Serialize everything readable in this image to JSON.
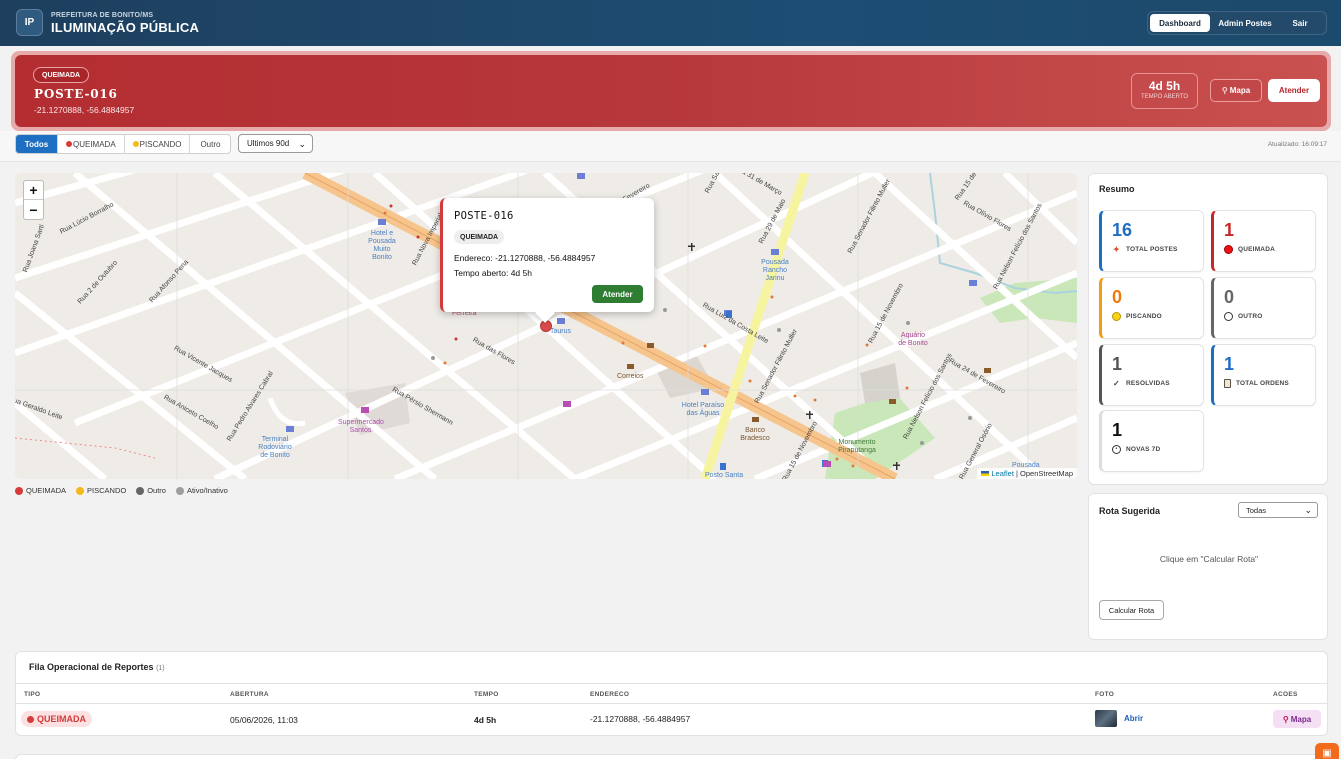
{
  "header": {
    "logo": "IP",
    "subtitle": "PREFEITURA DE BONITO/MS",
    "title": "ILUMINAÇÃO PÚBLICA",
    "nav": [
      {
        "label": "Dashboard",
        "active": true
      },
      {
        "label": "Admin Postes",
        "active": false
      },
      {
        "label": "Sair",
        "active": false
      }
    ]
  },
  "alert": {
    "badge": "QUEIMADA",
    "title": "POSTE-016",
    "coords": "-21.1270888, -56.4884957",
    "time_value": "4d 5h",
    "time_label": "TEMPO ABERTO",
    "map_button": "Mapa",
    "attend_button": "Atender"
  },
  "filters": {
    "segments": [
      "Todos",
      "QUEIMADA",
      "PISCANDO",
      "Outro"
    ],
    "period": "Ultimos 90d",
    "updated": "Atualizado: 16:09:17"
  },
  "map": {
    "zoom_in": "+",
    "zoom_out": "−",
    "attribution_leaflet": "Leaflet",
    "attribution_osm": "| OpenStreetMap",
    "popup": {
      "title": "POSTE-016",
      "badge": "QUEIMADA",
      "endereco": "Endereco: -21.1270888, -56.4884957",
      "tempo": "Tempo aberto: 4d 5h",
      "button": "Atender"
    },
    "labels": {
      "hotel_bonito": "Hotel e Pousada Muito Bonito",
      "pousada_rancho": "Pousada Rancho Jarinu",
      "terminal": "Terminal Rodoviário de Bonito",
      "supermercado": "Supermercado Santos",
      "correios": "Correios",
      "banco": "Banco Bradesco",
      "hotel_paraiso": "Hotel Paraíso das Águas",
      "monumento": "Monumento Piraputanga",
      "aquario": "Aquário de Bonito",
      "pousada": "Pousada",
      "taurus": "Taurus",
      "ferreira": "Ferreira",
      "posto": "Posto Santa",
      "rua_lucio": "Rua Lúcio Borralho",
      "rua_joana": "Rua Joana Sarti",
      "rua_2out": "Rua 2 de Outubro",
      "rua_afonso": "Rua Afonso Pena",
      "rua_vicente": "Rua Vicente Jacques",
      "rua_aniceto": "Rua Aniceto Coelho",
      "rua_pedro": "Rua Pedro Alvares Cabral",
      "rua_geraldo": "Rua Geraldo Leite",
      "rua_persio": "Rua Pérsio Shermann",
      "rua_flores": "Rua das Flores",
      "rua_luiz": "Rua Luiz da Costa Leite",
      "rua_29": "Rua 29 de Maio",
      "rua_senador": "Rua Senador Filinto Muller",
      "rua_15nov": "Rua 15 de Novembro",
      "rua_nelson": "Rua Nelson Felício dos Santos",
      "rua_24fev": "Rua 24 de Fevereiro",
      "rua_olivio": "Rua Olívio Flores",
      "rua_marco": "Rua 31 de Março",
      "rua_nova": "Rua Nova Imperial",
      "rua_24fev_top": "Rua 24 de Fevereiro",
      "rua_15_top": "Rua 15 de",
      "rua_general": "Rua General Osório",
      "rua_15nov_b": "Rua 15 de Novembro",
      "rua_nelson_b": "Rua Nelson Felício dos Santos",
      "rua_senador_b": "Rua Senador Filinto Muller",
      "rua_sa": "Rua Sa",
      "rua_vasc": "Rua Vasc"
    }
  },
  "legend": [
    {
      "label": "QUEIMADA",
      "color": "#d63b3b"
    },
    {
      "label": "PISCANDO",
      "color": "#f5b81a"
    },
    {
      "label": "Outro",
      "color": "#666666"
    },
    {
      "label": "Ativo/Inativo",
      "color": "#9e9e9e"
    }
  ],
  "resumo": {
    "title": "Resumo",
    "cards": [
      {
        "value": "16",
        "label": "TOTAL POSTES",
        "color": "#1e6fc2",
        "icon": "pin-icon"
      },
      {
        "value": "1",
        "label": "QUEIMADA",
        "color": "#c62828",
        "icon": "red-dot-icon"
      },
      {
        "value": "0",
        "label": "PISCANDO",
        "color": "#f39c12",
        "icon": "yellow-dot-icon"
      },
      {
        "value": "0",
        "label": "OUTRO",
        "color": "#666666",
        "icon": "circle-icon"
      },
      {
        "value": "1",
        "label": "RESOLVIDAS",
        "color": "#555555",
        "icon": "check-icon"
      },
      {
        "value": "1",
        "label": "TOTAL ORDENS",
        "color": "#1e6fc2",
        "icon": "clipboard-icon"
      },
      {
        "value": "1",
        "label": "NOVAS 7D",
        "color": "#111111",
        "icon": "clock-icon"
      }
    ]
  },
  "rota": {
    "title": "Rota Sugerida",
    "select": "Todas",
    "hint": "Clique em \"Calcular Rota\"",
    "button": "Calcular Rota"
  },
  "fila": {
    "title": "Fila Operacional de Reportes",
    "count": "(1)",
    "columns": [
      "TIPO",
      "ABERTURA",
      "TEMPO",
      "ENDERECO",
      "FOTO",
      "ACOES"
    ],
    "rows": [
      {
        "tipo": "QUEIMADA",
        "abertura": "05/06/2026, 11:03",
        "tempo": "4d 5h",
        "endereco": "-21.1270888, -56.4884957",
        "foto": "Abrir",
        "acao": "Mapa"
      }
    ]
  }
}
